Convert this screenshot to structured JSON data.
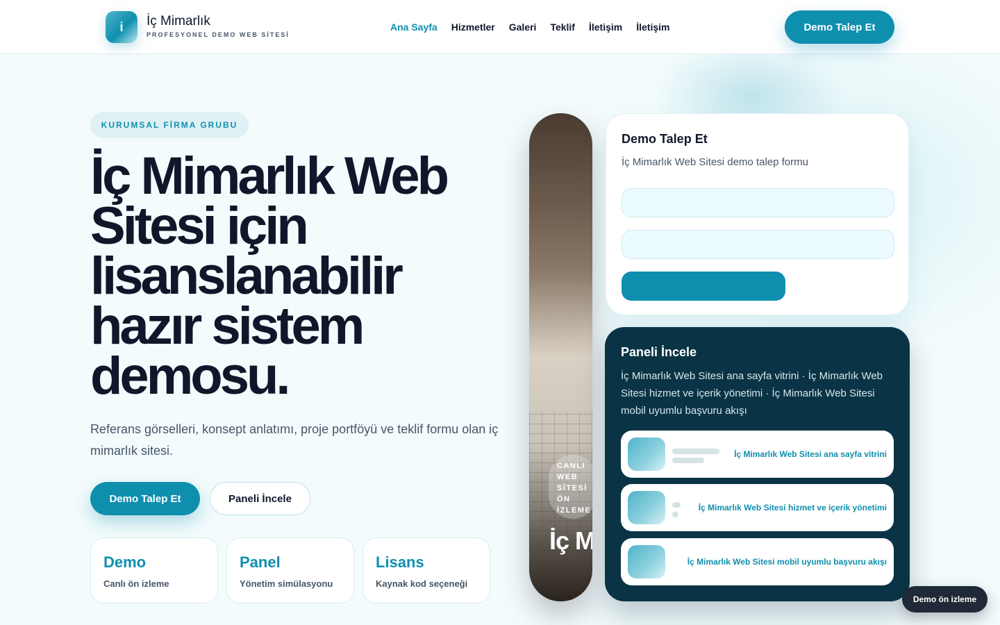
{
  "header": {
    "logo_letter": "i",
    "brand_name": "İç Mimarlık",
    "brand_sub": "PROFESYONEL DEMO WEB SİTESİ",
    "nav": [
      {
        "label": "Ana Sayfa",
        "active": true
      },
      {
        "label": "Hizmetler",
        "active": false
      },
      {
        "label": "Galeri",
        "active": false
      },
      {
        "label": "Teklif",
        "active": false
      },
      {
        "label": "İletişim",
        "active": false
      },
      {
        "label": "İletişim",
        "active": false
      }
    ],
    "cta_label": "Demo Talep Et"
  },
  "hero": {
    "eyebrow": "KURUMSAL FİRMA GRUBU",
    "title": "İç Mimarlık Web Sitesi için lisanslanabilir hazır sistem demosu.",
    "description": "Referans görselleri, konsept anlatımı, proje portföyü ve teklif formu olan iç mimarlık sitesi.",
    "primary_button": "Demo Talep Et",
    "secondary_button": "Paneli İncele",
    "stats": [
      {
        "title": "Demo",
        "subtitle": "Canlı ön izleme"
      },
      {
        "title": "Panel",
        "subtitle": "Yönetim simülasyonu"
      },
      {
        "title": "Lisans",
        "subtitle": "Kaynak kod seçeneği"
      }
    ]
  },
  "photo": {
    "badge": "CANLI WEB SİTESİ ÖN İZLEME",
    "title": "İç Mimarlık"
  },
  "form": {
    "title": "Demo Talep Et",
    "subtitle": "İç Mimarlık Web Sitesi demo talep formu"
  },
  "panel": {
    "title": "Paneli İncele",
    "description": "İç Mimarlık Web Sitesi ana sayfa vitrini · İç Mimarlık Web Sitesi hizmet ve içerik yönetimi · İç Mimarlık Web Sitesi mobil uyumlu başvuru akışı",
    "rows": [
      {
        "label": "İç Mimarlık Web Sitesi ana sayfa vitrini"
      },
      {
        "label": "İç Mimarlık Web Sitesi hizmet ve içerik yönetimi"
      },
      {
        "label": "İç Mimarlık Web Sitesi mobil uyumlu başvuru akışı"
      }
    ]
  },
  "floating": {
    "demo_label": "Demo ön izleme"
  },
  "colors": {
    "accent": "#0e8fae",
    "dark": "#0a3445",
    "text": "#0f172a",
    "muted": "#475569"
  }
}
